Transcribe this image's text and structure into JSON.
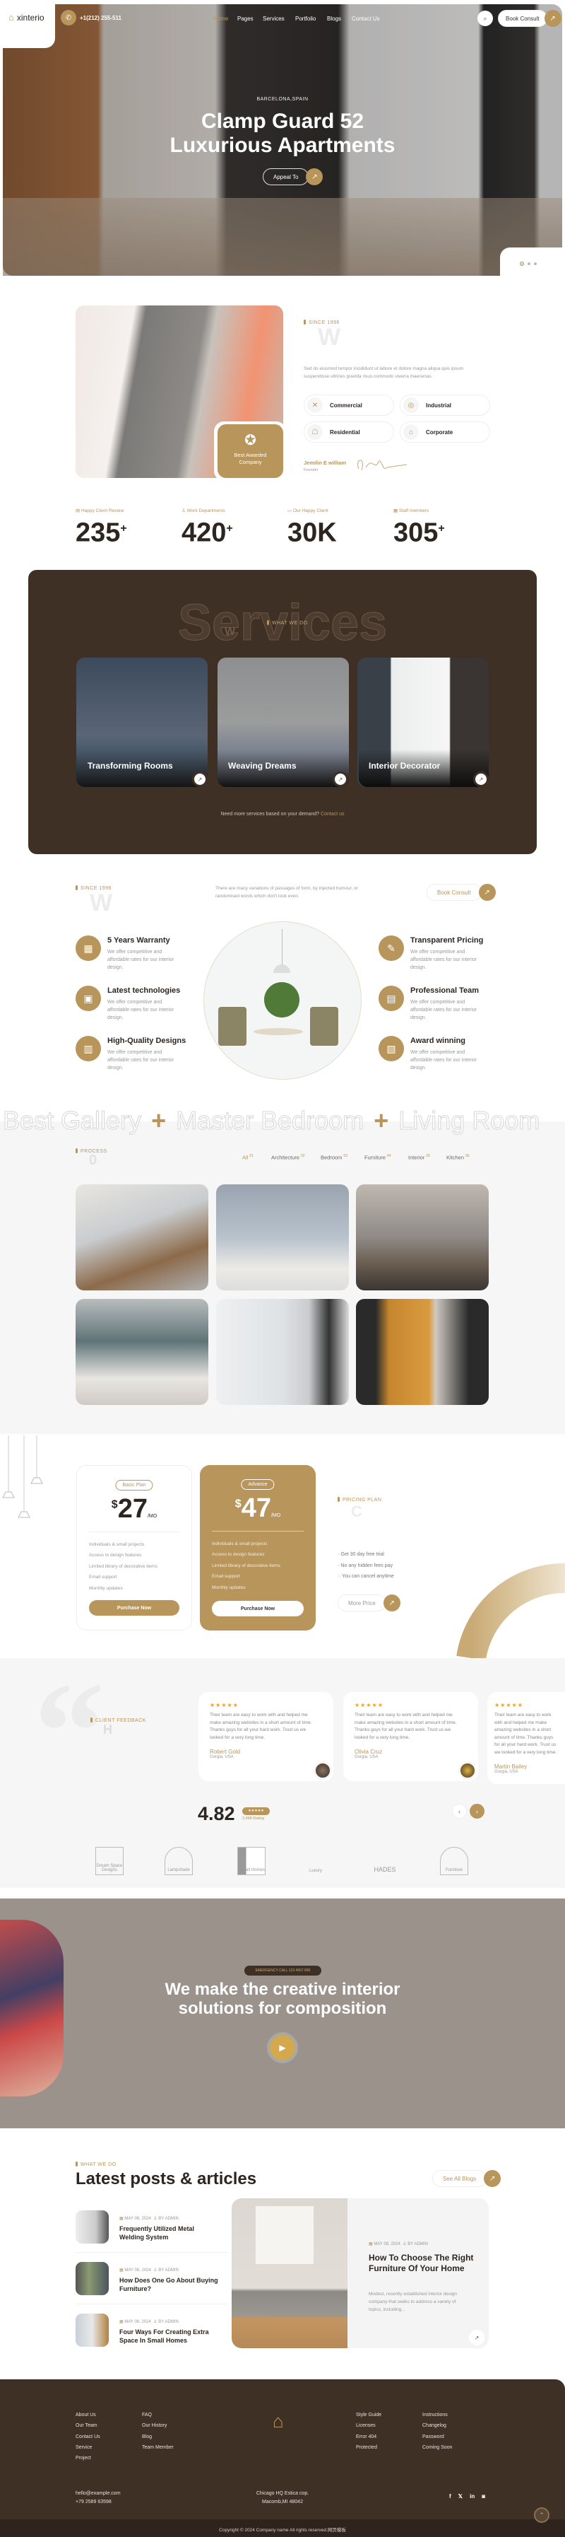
{
  "header": {
    "brand": "xinterio",
    "phone": "+1(212) 255-511",
    "nav": [
      "Home",
      "Pages",
      "Services",
      "Portfolio",
      "Blogs",
      "Contact Us"
    ],
    "active_nav": "Home",
    "book_consult": "Book Consult"
  },
  "hero": {
    "location": "BARCELONA,SPAIN",
    "title_line1": "Clamp Guard 52",
    "title_line2": "Luxurious Apartments",
    "cta": "Appeal To",
    "slides": 3,
    "active_slide": 1
  },
  "about": {
    "tag": "SINCE 1996",
    "ghost": "W",
    "paragraph": "Sed do eiusmod tempor incididunt ut labore et dolore magna aliqua quis ipsum suspendisse ultrices gravida risus commodo viverra maecenas.",
    "badge": "Best Awarded Company",
    "chips": [
      "Commercial",
      "Industrial",
      "Residential",
      "Corporate"
    ],
    "founder_name": "Jemilin E william",
    "founder_role": "Founder"
  },
  "stats": [
    {
      "label": "Happy Client Review",
      "value": "235",
      "suffix": "+"
    },
    {
      "label": "Work Departments",
      "value": "420",
      "suffix": "+"
    },
    {
      "label": "Our Happy Client",
      "value": "30K",
      "suffix": ""
    },
    {
      "label": "Staff members",
      "value": "305",
      "suffix": "+"
    }
  ],
  "services": {
    "ghost": "Services",
    "tag": "WHAT WE DO",
    "ghost_small": "W",
    "cards": [
      "Transforming Rooms",
      "Weaving Dreams",
      "Interior Decorator"
    ],
    "note": "Need more services based on your demand?",
    "note_link": "Contact us"
  },
  "why": {
    "tag": "SINCE 1996",
    "ghost": "W",
    "paragraph": "There are many variations of passages of form, by injected humour, or randomised words which don't look even.",
    "button": "Book Consult",
    "features": [
      {
        "title": "5 Years Warranty",
        "desc": "We offer competitive and affordable rates for our interior design."
      },
      {
        "title": "Latest technologies",
        "desc": "We offer competitive and affordable rates for our interior design."
      },
      {
        "title": "High-Quality Designs",
        "desc": "We offer competitive and affordable rates for our interior design."
      },
      {
        "title": "Transparent Pricing",
        "desc": "We offer competitive and affordable rates for our interior design."
      },
      {
        "title": "Professional Team",
        "desc": "We offer competitive and affordable rates for our interior design."
      },
      {
        "title": "Award winning",
        "desc": "We offer competitive and affordable rates for our interior design."
      }
    ]
  },
  "marquee": [
    "Best Gallery",
    "Master Bedroom",
    "Living Room"
  ],
  "gallery": {
    "tag": "PROCESS",
    "ghost": "0",
    "filters": [
      {
        "label": "All",
        "count": "01"
      },
      {
        "label": "Architecture",
        "count": "02"
      },
      {
        "label": "Bedroom",
        "count": "03"
      },
      {
        "label": "Furniture",
        "count": "04"
      },
      {
        "label": "Interior",
        "count": "05"
      },
      {
        "label": "Kitchen",
        "count": "06"
      }
    ],
    "active_filter": "All"
  },
  "pricing": {
    "plans": [
      {
        "name": "Basic Plan",
        "currency": "$",
        "price": "27",
        "period": "/MO",
        "features": [
          "Individuals & small projects",
          "Access to design features",
          "Limited library of decorative items",
          "Email support",
          "Monthly updates"
        ],
        "button": "Purchase Now"
      },
      {
        "name": "Advance",
        "currency": "$",
        "price": "47",
        "period": "/MO",
        "features": [
          "Individuals & small projects",
          "Access to design features",
          "Limited library of decorative items",
          "Email support",
          "Monthly updates"
        ],
        "button": "Purchase Now"
      }
    ],
    "tag": "PRICING PLAN",
    "ghost": "C",
    "checks": [
      "Get 30 day free trial",
      "No any hidden fees pay",
      "You can cancel anytime"
    ],
    "more_button": "More Price"
  },
  "testimonials": {
    "tag": "CLIENT FEEDBACK",
    "ghost": "H",
    "items": [
      {
        "stars": 5,
        "text": "Their team are easy to work with and helped me make amazing websites in a short amount of time. Thanks guys for all your hard work. Trust us we looked for a very long time.",
        "name": "Robert Gold",
        "location": "Gorgia, USA"
      },
      {
        "stars": 5,
        "text": "Their team are easy to work with and helped me make amazing websites in a short amount of time. Thanks guys for all your hard work. Trust us we looked for a very long time.",
        "name": "Olivia Cruz",
        "location": "Gorgia, USA"
      },
      {
        "stars": 5,
        "text": "Their team are easy to work with and helped me make amazing websites in a short amount of time. Thanks guys for all your hard work. Trust us we looked for a very long time.",
        "name": "Martin Bailey",
        "location": "Gorgia, USA"
      }
    ],
    "rating": "4.82",
    "rating_count": "2,488 Rating",
    "logos": [
      "Dream Space Designs",
      "Lampshade",
      "Cobalt Homes",
      "Luxury",
      "HADES",
      "Furniture"
    ]
  },
  "video": {
    "pill": "EMERGENCY CALL 123 4567 890",
    "title_line1": "We make the creative interior",
    "title_line2": "solutions for composition"
  },
  "blog": {
    "tag": "WHAT WE DO",
    "title": "Latest posts & articles",
    "button": "See All Blogs",
    "posts": [
      {
        "date": "MAY 08, 2024",
        "author": "BY ADMIN",
        "title": "Frequently Utilized Metal Welding System"
      },
      {
        "date": "MAY 08, 2024",
        "author": "BY ADMIN",
        "title": "How Does One Go About Buying Furniture?"
      },
      {
        "date": "MAY 08, 2024",
        "author": "BY ADMIN",
        "title": "Four Ways For Creating Extra Space In Small Homes"
      }
    ],
    "featured": {
      "date": "MAY 08, 2024",
      "author": "BY ADMIN",
      "title": "How To Choose The Right Furniture Of Your Home",
      "excerpt": "Modest, recently established interior design company that seeks to address a variety of topics, including..."
    }
  },
  "footer": {
    "col1": [
      "About Us",
      "Our Team",
      "Contact Us",
      "Service",
      "Project"
    ],
    "col2": [
      "FAQ",
      "Our History",
      "Blog",
      "Team Member"
    ],
    "col3": [
      "Style Guide",
      "Licenses",
      "Error 404",
      "Protected"
    ],
    "col4": [
      "Instructions",
      "Changelog",
      "Password",
      "Coming Soon"
    ],
    "email": "hello@example.com",
    "phone": "+79 2589 63598",
    "address_line1": "Chicago HQ Estica cop.",
    "address_line2": "Macomb,MI 48042",
    "socials": [
      "facebook",
      "x",
      "linkedin",
      "instagram"
    ],
    "copyright": "Copyright © 2024 Company name All rights reserved.网页模板"
  },
  "colors": {
    "accent": "#b8955a",
    "dark_brown": "#3f3026",
    "text": "#2d2520",
    "light_bg": "#f6f6f6"
  }
}
